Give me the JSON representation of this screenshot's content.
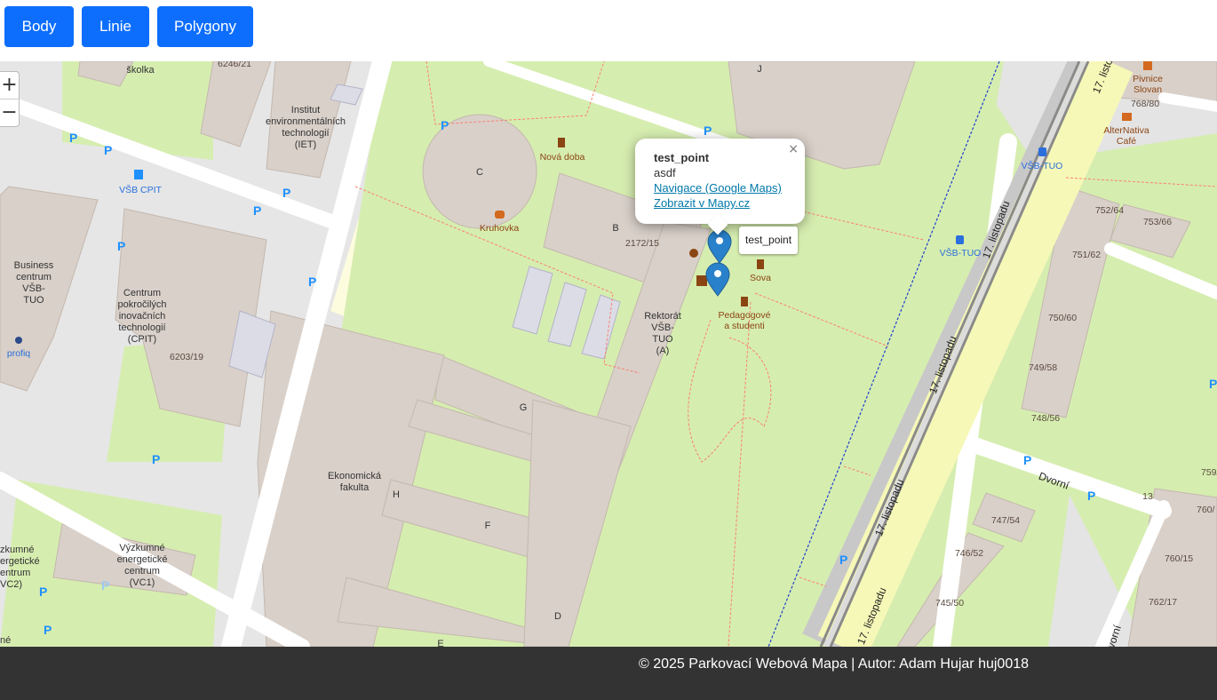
{
  "toolbar": {
    "buttons": [
      "Body",
      "Linie",
      "Polygony"
    ]
  },
  "map": {
    "zoom_in": "+",
    "zoom_out": "−",
    "labels": {
      "skolka": "školka",
      "parcel_6246": "6246/21",
      "iet_1": "Institut",
      "iet_2": "environmentálních",
      "iet_3": "technologií",
      "iet_4": "(IET)",
      "c": "C",
      "nova_doba": "Nová doba",
      "kruhovka": "Kruhovka",
      "b": "B",
      "parcel_2172": "2172/15",
      "j": "J",
      "vsb_cpit": "VŠB CPIT",
      "business_1": "Business",
      "business_2": "centrum",
      "business_3": "VŠB-",
      "business_4": "TUO",
      "profiq": "profiq",
      "cpit_1": "Centrum",
      "cpit_2": "pokročilých",
      "cpit_3": "inovačních",
      "cpit_4": "technologií",
      "cpit_5": "(CPIT)",
      "parcel_6203": "6203/19",
      "rektorat_1": "Rektorát",
      "rektorat_2": "VŠB-",
      "rektorat_3": "TUO",
      "rektorat_4": "(A)",
      "sova": "Sova",
      "pedagog_1": "Pedagogové",
      "pedagog_2": "a studenti",
      "g": "G",
      "ekonom_1": "Ekonomická",
      "ekonom_2": "fakulta",
      "h": "H",
      "f": "F",
      "d": "D",
      "e": "E",
      "vyzk_1": "Výzkumné",
      "vyzk_2": "energetické",
      "vyzk_3": "centrum",
      "vyzk_4": "(VC1)",
      "vc2_1": "zkumné",
      "vc2_2": "ergetické",
      "vc2_3": "entrum",
      "vc2_4": "VC2)",
      "ne": "né",
      "pivnice_1": "Pivnice",
      "pivnice_2": "Slovan",
      "parcel_768_80": "768/80",
      "alternativa_1": "AlterNativa",
      "alternativa_2": "Café",
      "vsb_tuo_a": "VŠB-TUO",
      "vsb_tuo_b": "VŠB-TUO",
      "p_752": "752/64",
      "p_753": "753/66",
      "p_751": "751/62",
      "p_750": "750/60",
      "p_749": "749/58",
      "p_748": "748/56",
      "p_747": "747/54",
      "p_746": "746/52",
      "p_745": "745/50",
      "p_759": "759/",
      "p_760a": "760/",
      "p_760b": "760/15",
      "p_762": "762/17",
      "thirteen": "13",
      "dvorni_a": "Dvorní",
      "dvorni_b": "vorní",
      "listopadu": "17. listopadu",
      "listopadu_short": "17. listo",
      "parking": "P"
    },
    "marker_tooltip": "test_point",
    "popup": {
      "title": "test_point",
      "description": "asdf",
      "link_google": "Navigace (Google Maps)",
      "link_mapy": "Zobrazit v Mapy.cz",
      "close": "×"
    }
  },
  "footer": {
    "text": "© 2025 Parkovací Webová Mapa | Autor: Adam Hujar huj0018"
  },
  "colors": {
    "button": "#0d6efd",
    "footer": "#333333",
    "grass": "#d6edb0",
    "building": "#d9d0c9",
    "road": "#ffffff",
    "main_road": "#f6f8b7",
    "marker": "#2a81cb"
  }
}
